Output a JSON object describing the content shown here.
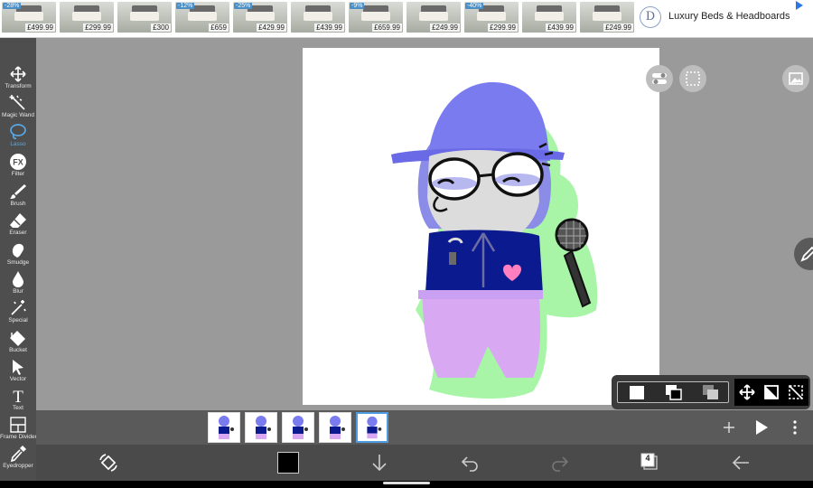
{
  "ad": {
    "title": "Luxury Beds & Headboards",
    "logo_letter": "D",
    "info_icon": "info-triangle-icon",
    "products": [
      {
        "discount": "-28%",
        "price": "£499.99"
      },
      {
        "discount": "",
        "price": "£299.99"
      },
      {
        "discount": "",
        "price": "£300"
      },
      {
        "discount": "-12%",
        "price": "£659"
      },
      {
        "discount": "-25%",
        "price": "£429.99"
      },
      {
        "discount": "",
        "price": "£439.99"
      },
      {
        "discount": "-9%",
        "price": "£659.99"
      },
      {
        "discount": "",
        "price": "£249.99"
      },
      {
        "discount": "-40%",
        "price": "£299.99"
      },
      {
        "discount": "",
        "price": "£439.99"
      },
      {
        "discount": "",
        "price": "£249.99"
      }
    ]
  },
  "tools": [
    {
      "label": "Transform",
      "icon": "move-arrows-icon"
    },
    {
      "label": "Magic Wand",
      "icon": "magic-wand-icon"
    },
    {
      "label": "Lasso",
      "icon": "lasso-icon",
      "active": true
    },
    {
      "label": "Filter",
      "icon": "fx-icon"
    },
    {
      "label": "Brush",
      "icon": "brush-icon"
    },
    {
      "label": "Eraser",
      "icon": "eraser-icon"
    },
    {
      "label": "Smudge",
      "icon": "smudge-icon"
    },
    {
      "label": "Blur",
      "icon": "blur-drop-icon"
    },
    {
      "label": "Special",
      "icon": "special-wand-icon"
    },
    {
      "label": "Bucket",
      "icon": "bucket-icon"
    },
    {
      "label": "Vector",
      "icon": "vector-arrow-icon"
    },
    {
      "label": "Text",
      "icon": "text-icon"
    },
    {
      "label": "Frame Divider",
      "icon": "frame-divider-icon"
    },
    {
      "label": "Eyedropper",
      "icon": "eyedropper-icon"
    }
  ],
  "fx_text": "FX",
  "text_glyph": "T",
  "frames_count": "4",
  "colors": {
    "accent": "#4f9be0",
    "toolbar_bg": "#4e4e4e",
    "primary_color": "#000000",
    "hat": "#7b7bf0",
    "jacket": "#0b1a8e",
    "pants": "#d9a8f3",
    "highlight": "#a8f5a8"
  }
}
